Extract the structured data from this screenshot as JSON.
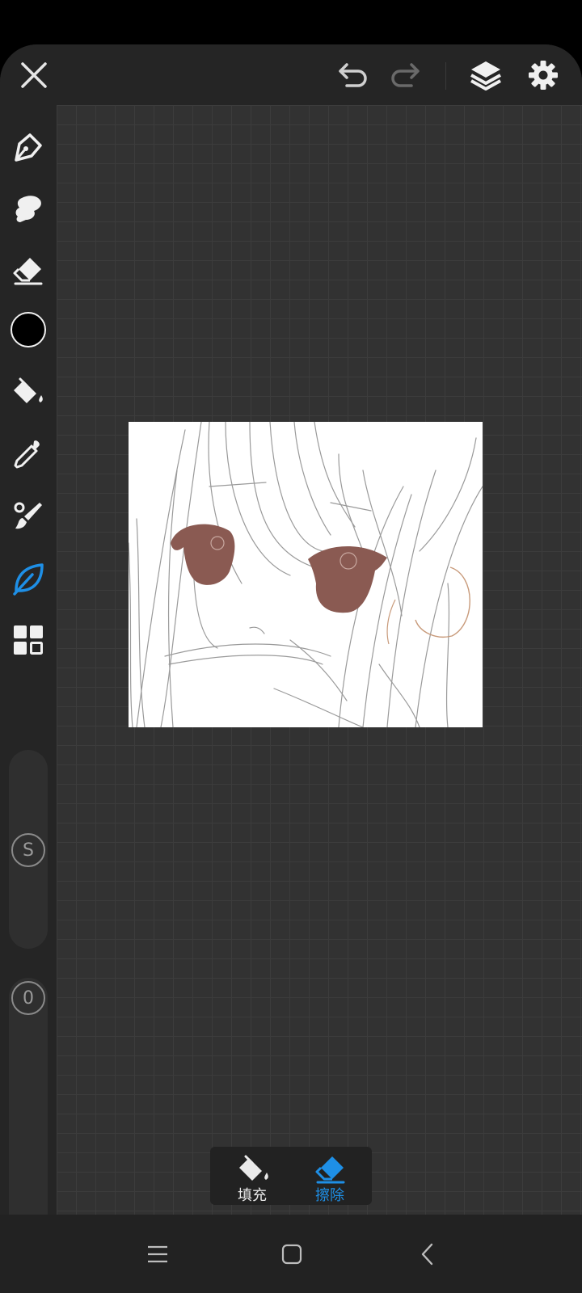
{
  "toolbar": {
    "close_icon": "close-icon",
    "undo_icon": "undo-icon",
    "redo_icon": "redo-icon",
    "layers_icon": "layers-icon",
    "settings_icon": "gear-icon"
  },
  "sidebar": {
    "tools": [
      {
        "name": "pen-tool",
        "icon": "pen-nib-icon",
        "active": false
      },
      {
        "name": "smudge-tool",
        "icon": "smudge-icon",
        "active": false
      },
      {
        "name": "eraser-tool",
        "icon": "eraser-icon",
        "active": false
      },
      {
        "name": "color-picker",
        "icon": "color-swatch",
        "active": false,
        "color": "#000000"
      },
      {
        "name": "fill-tool",
        "icon": "paint-bucket-icon",
        "active": false
      },
      {
        "name": "eyedropper-tool",
        "icon": "eyedropper-icon",
        "active": false
      },
      {
        "name": "brush-tool",
        "icon": "brush-icon",
        "active": false
      },
      {
        "name": "leaf-tool",
        "icon": "leaf-icon",
        "active": true
      },
      {
        "name": "more-tools",
        "icon": "grid-icon",
        "active": false
      }
    ],
    "size_slider": {
      "label": "S"
    },
    "opacity_slider": {
      "label": "0"
    }
  },
  "popup": {
    "fill_label": "填充",
    "erase_label": "擦除",
    "selected": "erase"
  },
  "colors": {
    "accent": "#1e8fe6",
    "background": "#252525",
    "canvas_grid": "#323232",
    "eye_color": "#8a5a52"
  },
  "navbar": {
    "menu_icon": "menu-icon",
    "home_icon": "home-square-icon",
    "back_icon": "back-chevron-icon"
  }
}
